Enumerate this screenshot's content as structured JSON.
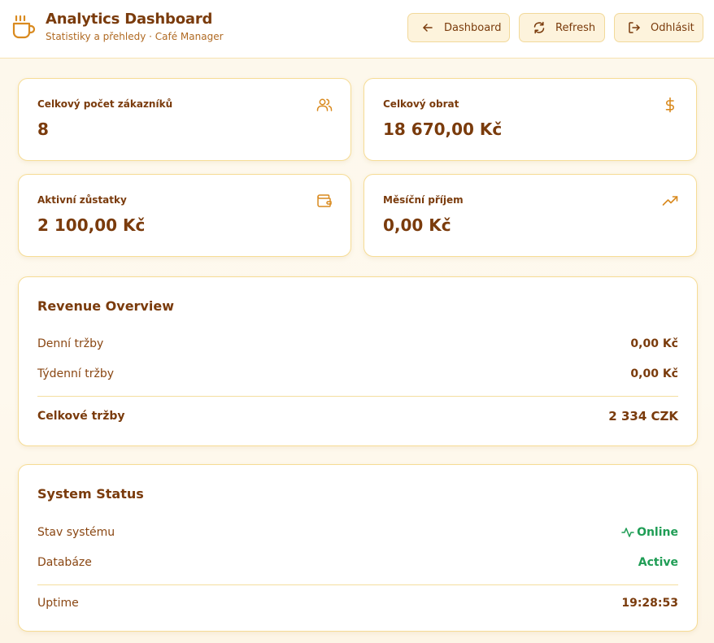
{
  "header": {
    "title": "Analytics Dashboard",
    "subtitle": "Statistiky a přehledy · Café Manager",
    "logo_icon": "coffee-cup-icon",
    "buttons": {
      "dashboard": "Dashboard",
      "refresh": "Refresh",
      "logout": "Odhlásit"
    }
  },
  "stats": [
    {
      "label": "Celkový počet zákazníků",
      "value": "8",
      "icon": "users-icon"
    },
    {
      "label": "Celkový obrat",
      "value": "18 670,00 Kč",
      "icon": "dollar-icon"
    },
    {
      "label": "Aktivní zůstatky",
      "value": "2 100,00 Kč",
      "icon": "wallet-icon"
    },
    {
      "label": "Měsíční příjem",
      "value": "0,00 Kč",
      "icon": "trending-up-icon"
    }
  ],
  "revenue": {
    "title": "Revenue Overview",
    "daily_label": "Denní tržby",
    "daily_value": "0,00 Kč",
    "weekly_label": "Týdenní tržby",
    "weekly_value": "0,00 Kč",
    "total_label": "Celkové tržby",
    "total_value": "2 334 CZK"
  },
  "system": {
    "title": "System Status",
    "status_label": "Stav systému",
    "status_value": "Online",
    "db_label": "Databáze",
    "db_value": "Active",
    "uptime_label": "Uptime",
    "uptime_value": "19:28:53"
  },
  "colors": {
    "accent": "#d98a1f",
    "text": "#7a3b0c",
    "success": "#1f9d55",
    "border": "#f6dc95"
  }
}
